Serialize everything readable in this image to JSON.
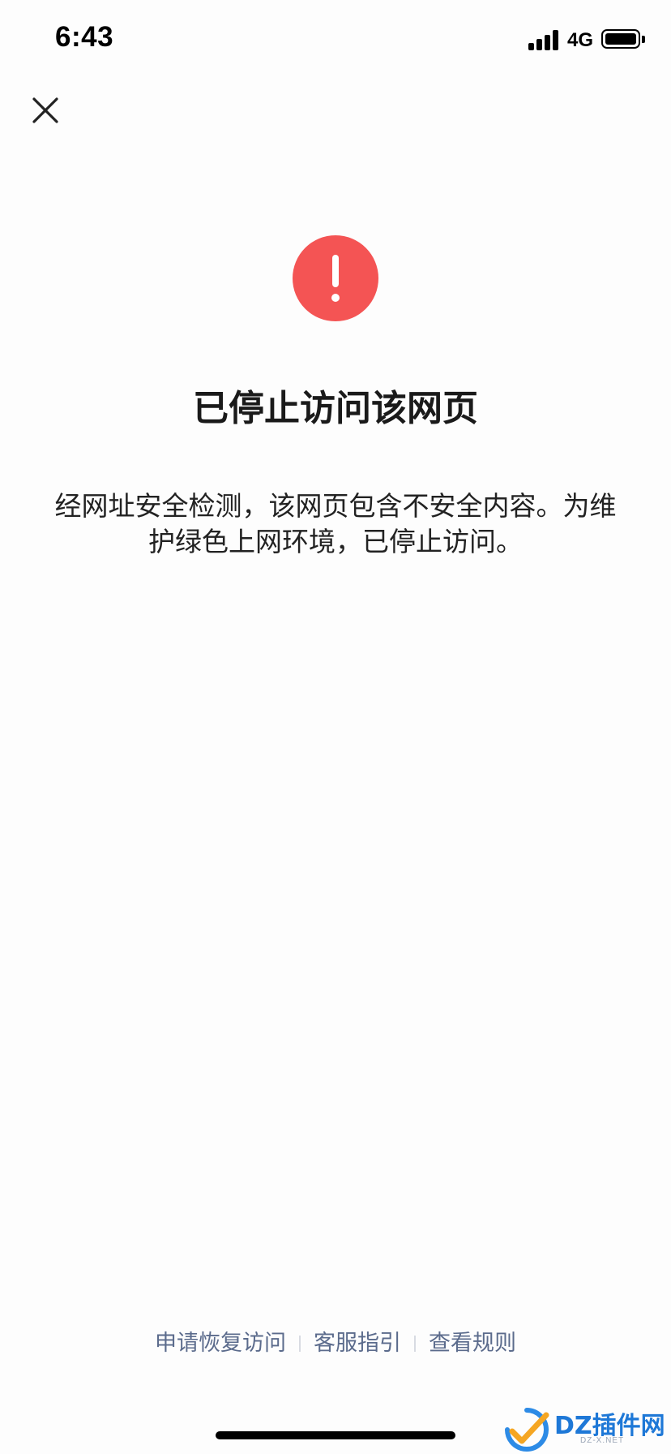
{
  "status_bar": {
    "time": "6:43",
    "network": "4G",
    "icons": [
      "signal-icon",
      "battery-icon"
    ]
  },
  "close_icon": "close-icon",
  "warning_icon": {
    "name": "exclamation-icon",
    "color": "#f45454"
  },
  "page": {
    "title": "已停止访问该网页",
    "description": "经网址安全检测，该网页包含不安全内容。为维护绿色上网环境，已停止访问。"
  },
  "footer": {
    "links": [
      {
        "label": "申请恢复访问"
      },
      {
        "label": "客服指引"
      },
      {
        "label": "查看规则"
      }
    ],
    "link_color": "#5b6b8c"
  },
  "watermark": {
    "text": "DZ插件网",
    "sub": "DZ-X.NET",
    "color": "#1e78d7"
  }
}
